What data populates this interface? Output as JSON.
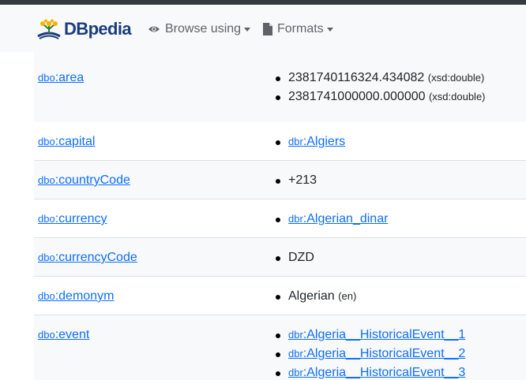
{
  "brand": {
    "name": "DBpedia"
  },
  "nav": {
    "browse_label": "Browse using",
    "formats_label": "Formats"
  },
  "icons": {
    "browse": "eye-icon",
    "formats": "document-icon",
    "logo": "dbpedia-logo-icon"
  },
  "colors": {
    "link": "#0d6efd",
    "brand": "#1a3d7c",
    "topbar": "#343a40"
  },
  "rows": [
    {
      "prefix": "dbo",
      "prop": ":area",
      "values": [
        {
          "text": "2381740116324.434082",
          "type": "(xsd:double)"
        },
        {
          "text": "2381741000000.000000",
          "type": "(xsd:double)"
        }
      ]
    },
    {
      "prefix": "dbo",
      "prop": ":capital",
      "values": [
        {
          "prefix": "dbr",
          "text": ":Algiers"
        }
      ]
    },
    {
      "prefix": "dbo",
      "prop": ":countryCode",
      "values": [
        {
          "text": "+213"
        }
      ]
    },
    {
      "prefix": "dbo",
      "prop": ":currency",
      "values": [
        {
          "prefix": "dbr",
          "text": ":Algerian_dinar"
        }
      ]
    },
    {
      "prefix": "dbo",
      "prop": ":currencyCode",
      "values": [
        {
          "text": "DZD"
        }
      ]
    },
    {
      "prefix": "dbo",
      "prop": ":demonym",
      "values": [
        {
          "text": "Algerian",
          "type": "(en)"
        }
      ]
    },
    {
      "prefix": "dbo",
      "prop": ":event",
      "values": [
        {
          "prefix": "dbr",
          "text": ":Algeria__HistoricalEvent__1"
        },
        {
          "prefix": "dbr",
          "text": ":Algeria__HistoricalEvent__2"
        },
        {
          "prefix": "dbr",
          "text": ":Algeria__HistoricalEvent__3"
        }
      ]
    }
  ]
}
